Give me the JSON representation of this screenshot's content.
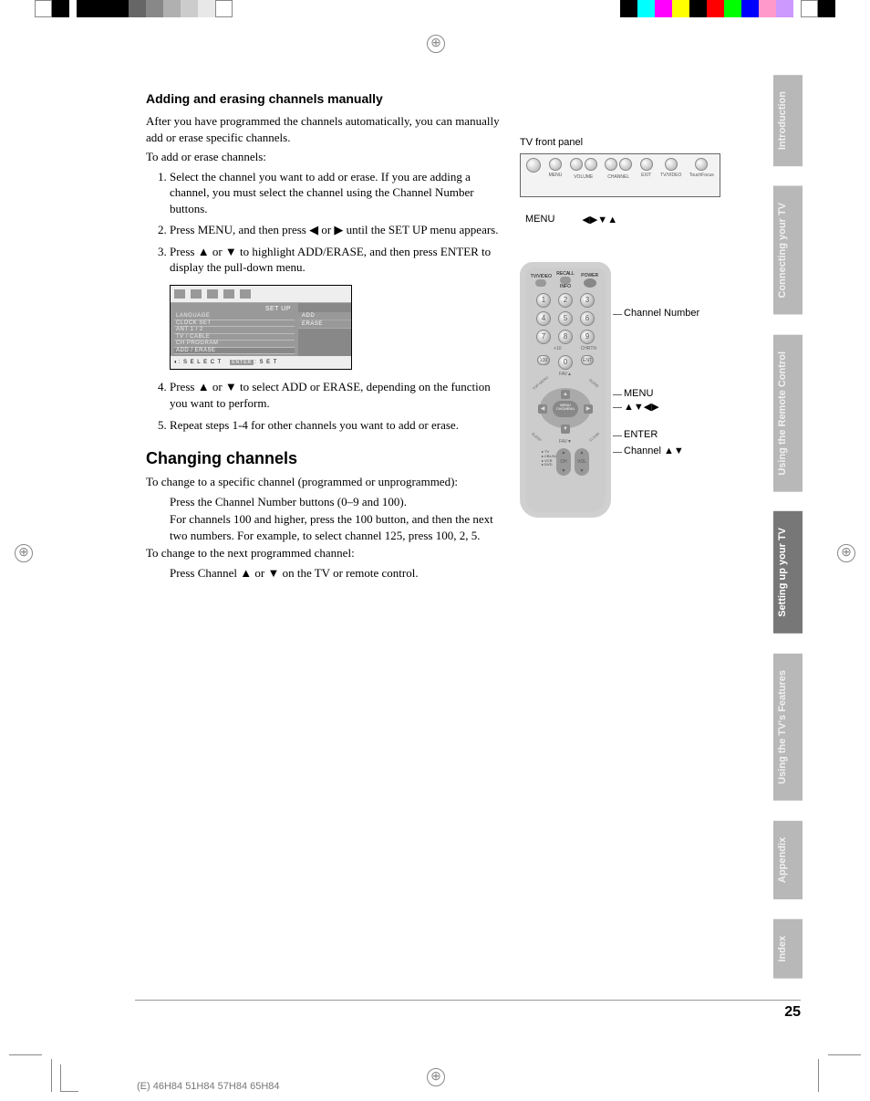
{
  "heading1": "Adding and erasing channels manually",
  "p1": "After you have programmed the channels automatically, you can manually add or erase specific channels.",
  "p2": "To add or erase channels:",
  "steps_a": [
    "Select the channel you want to add or erase. If you are adding a channel, you must select the channel using the Channel Number buttons.",
    "Press MENU, and then press ◀ or ▶ until the SET UP menu appears.",
    "Press ▲ or ▼ to highlight ADD/ERASE, and then press ENTER to display the pull-down menu."
  ],
  "steps_b": [
    "Press ▲ or ▼ to select ADD or ERASE, depending on the function you want to perform.",
    "Repeat steps 1-4 for other channels you want to add or erase."
  ],
  "menu": {
    "header": "SET UP",
    "items": [
      "LANGUAGE",
      "CLOCK SET",
      "ANT 1 / 2",
      "TV / CABLE",
      "CH PROGRAM",
      "ADD / ERASE"
    ],
    "options": [
      "ADD",
      "ERASE"
    ],
    "footer_select": ": S E L E C T",
    "footer_enter": "ENTER",
    "footer_set": ": S E T"
  },
  "heading2": "Changing channels",
  "p3": "To change to a specific channel (programmed or unprogrammed):",
  "p3a": "Press the Channel Number buttons (0–9 and 100).",
  "p3b": "For channels 100 and higher, press the 100 button, and then the next two numbers. For example, to select channel 125, press 100, 2, 5.",
  "p4": "To change to the next programmed channel:",
  "p4a": "Press Channel ▲ or ▼ on the TV or remote control.",
  "tv_label": "TV front panel",
  "tv_buttons": {
    "menu": "MENU",
    "volume": "VOLUME",
    "channel": "CHANNEL",
    "exit": "EXIT",
    "tvvideo": "TV/VIDEO",
    "touchfocus": "TouchFocus"
  },
  "tv_caption_menu": "MENU",
  "tv_caption_arrows": "◀▶▼▲",
  "remote": {
    "top": {
      "tvvideo": "TV/VIDEO",
      "recall": "RECALL",
      "info": "INFO",
      "power": "POWER"
    },
    "extra": {
      "plus10": "+10",
      "chrtn": "CHRTN",
      "hundred": "100"
    },
    "fav_up": "FAV▲",
    "fav_down": "FAV▼",
    "menu_center_1": "MENU",
    "menu_center_2": "CHCMENU",
    "corners": {
      "tl": "TOP MENU",
      "tr": "GUIDE",
      "bl": "SLEEP",
      "br": "CLEAR"
    },
    "rockers": {
      "ch": "CH",
      "vol": "VOL"
    },
    "mode": [
      "TV",
      "CBL/SAT",
      "VCR",
      "DVD"
    ]
  },
  "callouts": {
    "channel_number": "Channel Number",
    "menu": "MENU",
    "menu_arrows": "▲▼◀▶",
    "enter": "ENTER",
    "channel_ud": "Channel ▲▼"
  },
  "tabs": [
    "Introduction",
    "Connecting your TV",
    "Using the Remote Control",
    "Setting up your TV",
    "Using the TV's Features",
    "Appendix",
    "Index"
  ],
  "page_number": "25",
  "footer": "(E) 46H84 51H84 57H84 65H84"
}
